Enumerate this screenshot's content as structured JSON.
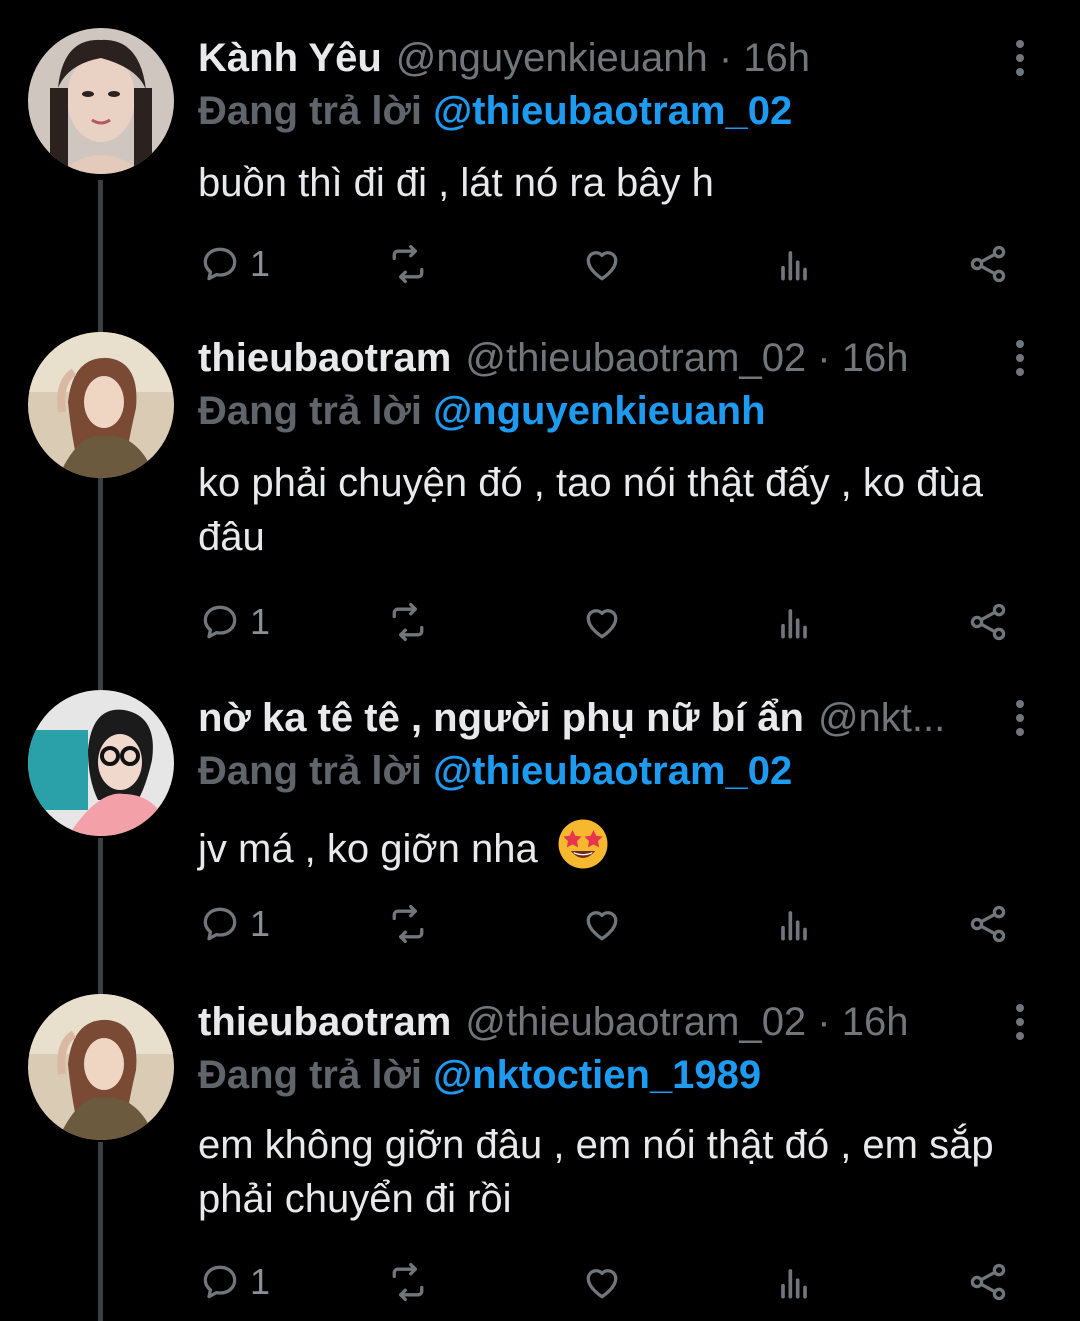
{
  "tweets": [
    {
      "name": "Kành Yêu",
      "handle": "@nguyenkieuanh · 16h",
      "reply_prefix": "Đang trả lời ",
      "reply_to": "@thieubaotram_02",
      "text": "buồn thì đi đi , lát nó ra bây h",
      "reply_count": "1"
    },
    {
      "name": "thieubaotram",
      "handle": "@thieubaotram_02 · 16h",
      "reply_prefix": "Đang trả lời ",
      "reply_to": "@nguyenkieuanh",
      "text": "ko phải chuyện đó , tao nói thật đấy , ko đùa đâu",
      "reply_count": "1"
    },
    {
      "name": "nờ ka tê tê , người phụ nữ bí ẩn",
      "handle": "@nkt...",
      "reply_prefix": "Đang trả lời ",
      "reply_to": "@thieubaotram_02",
      "text": "jv má , ko giỡn nha",
      "emoji": "star-struck-emoji",
      "reply_count": "1"
    },
    {
      "name": "thieubaotram",
      "handle": "@thieubaotram_02 · 16h",
      "reply_prefix": "Đang trả lời ",
      "reply_to": "@nktoctien_1989",
      "text": "em không giỡn đâu , em nói thật đó , em sắp phải chuyển đi rồi",
      "reply_count": "1"
    }
  ],
  "icons": {
    "reply": "reply-icon",
    "retweet": "retweet-icon",
    "like": "heart-icon",
    "views": "views-icon",
    "share": "share-icon",
    "menu": "more-vertical-icon"
  },
  "colors": {
    "background": "#000000",
    "text": "#e7e9ea",
    "muted": "#71767b",
    "link": "#1d9bf0",
    "thread_line": "#3a3f44"
  }
}
